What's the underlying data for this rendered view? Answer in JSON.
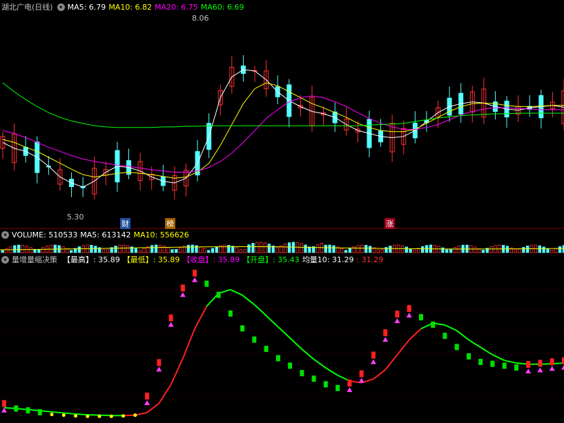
{
  "main": {
    "stock_title": "湖北广电(日线)",
    "ma5": "MA5: 6.79",
    "ma10": "MA10: 6.82",
    "ma20": "MA20: 6.75",
    "ma60": "MA60: 6.69",
    "high_label": "8.06",
    "low_label": "5.30",
    "tags": [
      "财",
      "榜",
      "涨"
    ]
  },
  "volume": {
    "label": "VOLUME: 510533",
    "ma5": "MA5: 613142",
    "ma10": "MA10: 556626"
  },
  "indicator": {
    "name": "量增量缩决策",
    "high_k": "【最高】",
    "high_v": ": 35.89",
    "low_k": "【最低】",
    "low_v": ": 35.89",
    "close_k": "【收盘】",
    "close_v": ": 35.89",
    "open_k": "【开盘】",
    "open_v": ": 35.43",
    "avg_k": "均量10",
    "avg_v": ": 31.29",
    "avg_v2": ": 31.29"
  },
  "colors": {
    "up": "#ff3232",
    "down": "#54ffff",
    "ma5": "#ffffff",
    "ma10": "#ffff00",
    "ma20": "#ff00ff",
    "ma60": "#00ff00",
    "sep": "#800000"
  },
  "chart_data": [
    {
      "type": "candlestick",
      "title": "湖北广电(日线)",
      "ylim": [
        5.0,
        8.3
      ],
      "series": [
        {
          "name": "MA5",
          "values": [
            6.2,
            6.1,
            6.05,
            5.95,
            5.8,
            5.62,
            5.52,
            5.45,
            5.55,
            5.7,
            5.8,
            5.78,
            5.72,
            5.62,
            5.55,
            5.52,
            5.6,
            5.85,
            6.3,
            6.95,
            7.3,
            7.42,
            7.4,
            7.25,
            7.05,
            6.9,
            6.8,
            6.72,
            6.68,
            6.62,
            6.5,
            6.4,
            6.35,
            6.3,
            6.28,
            6.3,
            6.4,
            6.55,
            6.7,
            6.8,
            6.85,
            6.88,
            6.86,
            6.8,
            6.76,
            6.74,
            6.78,
            6.8,
            6.82,
            6.79
          ]
        },
        {
          "name": "MA10",
          "values": [
            6.25,
            6.2,
            6.12,
            6.05,
            5.95,
            5.85,
            5.75,
            5.66,
            5.62,
            5.65,
            5.68,
            5.7,
            5.68,
            5.66,
            5.63,
            5.6,
            5.62,
            5.7,
            5.85,
            6.15,
            6.5,
            6.85,
            7.1,
            7.2,
            7.15,
            7.05,
            6.95,
            6.85,
            6.78,
            6.7,
            6.62,
            6.52,
            6.45,
            6.4,
            6.38,
            6.38,
            6.42,
            6.52,
            6.62,
            6.72,
            6.8,
            6.85,
            6.86,
            6.85,
            6.82,
            6.8,
            6.8,
            6.81,
            6.82,
            6.82
          ]
        },
        {
          "name": "MA20",
          "values": [
            6.4,
            6.35,
            6.28,
            6.2,
            6.12,
            6.05,
            5.98,
            5.92,
            5.88,
            5.85,
            5.82,
            5.8,
            5.77,
            5.74,
            5.72,
            5.7,
            5.7,
            5.72,
            5.78,
            5.88,
            6.02,
            6.2,
            6.4,
            6.6,
            6.75,
            6.88,
            6.95,
            6.98,
            6.95,
            6.88,
            6.8,
            6.7,
            6.6,
            6.52,
            6.46,
            6.42,
            6.42,
            6.45,
            6.5,
            6.58,
            6.66,
            6.72,
            6.76,
            6.78,
            6.78,
            6.77,
            6.76,
            6.75,
            6.75,
            6.75
          ]
        },
        {
          "name": "MA60",
          "values": [
            7.2,
            7.05,
            6.92,
            6.8,
            6.7,
            6.62,
            6.56,
            6.52,
            6.48,
            6.46,
            6.45,
            6.45,
            6.45,
            6.45,
            6.46,
            6.46,
            6.47,
            6.47,
            6.48,
            6.48,
            6.48,
            6.48,
            6.48,
            6.48,
            6.48,
            6.48,
            6.48,
            6.48,
            6.48,
            6.48,
            6.48,
            6.48,
            6.49,
            6.5,
            6.51,
            6.52,
            6.55,
            6.58,
            6.61,
            6.63,
            6.65,
            6.66,
            6.67,
            6.68,
            6.68,
            6.69,
            6.69,
            6.69,
            6.69,
            6.69
          ]
        }
      ]
    },
    {
      "type": "bar",
      "title": "VOLUME",
      "series": [
        {
          "name": "VOLUME",
          "values": [
            510533
          ]
        },
        {
          "name": "MA5",
          "values": [
            613142
          ]
        },
        {
          "name": "MA10",
          "values": [
            556626
          ]
        }
      ]
    },
    {
      "type": "line",
      "title": "量增量缩决策",
      "ylim": [
        0,
        40
      ],
      "series": [
        {
          "name": "量增量缩",
          "values": [
            3.0,
            2.5,
            2.0,
            1.5,
            1.0,
            0.8,
            0.6,
            0.5,
            0.5,
            0.5,
            0.6,
            0.8,
            5.0,
            14.0,
            26.0,
            34.0,
            38.0,
            36.0,
            33.0,
            28.0,
            24.0,
            21.0,
            18.5,
            16.0,
            14.0,
            12.0,
            10.5,
            9.0,
            8.0,
            8.5,
            11.0,
            16.0,
            22.0,
            27.0,
            28.5,
            27.0,
            25.0,
            22.0,
            19.0,
            16.5,
            15.0,
            14.5,
            14.0,
            13.5,
            13.5,
            13.8,
            14.2,
            14.5
          ]
        },
        {
          "name": "均量10",
          "values": [
            2.8,
            2.6,
            2.3,
            2.0,
            1.7,
            1.4,
            1.1,
            0.9,
            0.8,
            0.7,
            0.7,
            0.8,
            1.5,
            4.0,
            9.0,
            16.0,
            24.0,
            30.0,
            33.5,
            34.5,
            33.0,
            30.5,
            27.5,
            24.5,
            21.5,
            18.5,
            15.8,
            13.5,
            11.5,
            10.0,
            9.5,
            10.5,
            13.0,
            17.0,
            21.0,
            24.0,
            25.5,
            25.0,
            23.5,
            21.0,
            19.0,
            17.0,
            15.5,
            14.8,
            14.5,
            14.5,
            14.6,
            14.8
          ]
        }
      ]
    }
  ]
}
